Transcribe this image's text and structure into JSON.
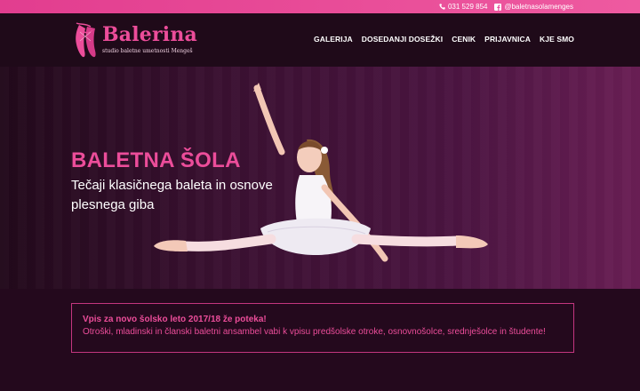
{
  "topbar": {
    "phone_icon": "phone-icon",
    "phone": "031 529 854",
    "facebook_icon": "facebook-icon",
    "facebook": "@baletnasolamenges"
  },
  "brand": {
    "name": "Balerina",
    "tagline": "studio baletne umetnosti Mengeš",
    "color": "#ec4d9a"
  },
  "nav": {
    "items": [
      {
        "label": "GALERIJA"
      },
      {
        "label": "DOSEDANJI DOSEŽKI"
      },
      {
        "label": "CENIK"
      },
      {
        "label": "PRIJAVNICA"
      },
      {
        "label": "KJE SMO"
      }
    ]
  },
  "hero": {
    "title": "BALETNA ŠOLA",
    "subtitle": "Tečaji klasičnega baleta in osnove plesnega giba"
  },
  "notice": {
    "title": "Vpis za novo šolsko leto 2017/18 že poteka!",
    "text": "Otroški, mladinski in članski baletni ansambel vabi k vpisu predšolske otroke, osnovnošolce, srednješolce in študente!"
  }
}
